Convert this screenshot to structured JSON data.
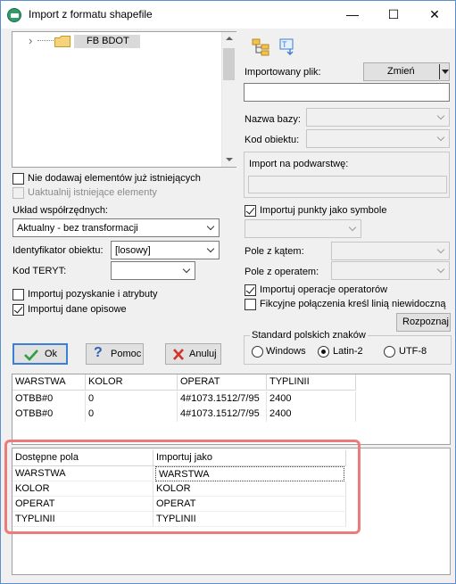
{
  "window": {
    "title": "Import z formatu shapefile",
    "minimize_glyph": "—",
    "maximize_glyph": "☐",
    "close_glyph": "✕"
  },
  "tree": {
    "node_label": "FB BDOT",
    "expand_glyph": "›"
  },
  "left_options": {
    "no_add_existing": "Nie dodawaj elementów już istniejących",
    "update_existing": "Uaktualnij istniejące elementy",
    "coord_system_label": "Układ współrzędnych:",
    "coord_system_value": "Aktualny - bez transformacji",
    "object_id_label": "Identyfikator  obiektu:",
    "object_id_value": "[losowy]",
    "teryt_label": "Kod TERYT:",
    "teryt_value": "",
    "import_acquisition": "Importuj pozyskanie i atrybuty",
    "import_descriptive": "Importuj dane opisowe"
  },
  "checks": {
    "no_add_existing": false,
    "update_existing": false,
    "import_acquisition": false,
    "import_descriptive": true,
    "import_points": true,
    "import_operator_ops": true,
    "fictional_connections": false
  },
  "buttons": {
    "ok": "Ok",
    "help": "Pomoc",
    "cancel": "Anuluj",
    "change": "Zmień",
    "detect": "Rozpoznaj"
  },
  "right_panel": {
    "imported_file_label": "Importowany plik:",
    "imported_file_value": "",
    "db_name_label": "Nazwa bazy:",
    "object_code_label": "Kod obiektu:",
    "import_sublayer_label": "Import na podwarstwę:",
    "import_points_label": "Importuj punkty jako symbole",
    "angle_field_label": "Pole z kątem:",
    "operator_field_label": "Pole z operatem:",
    "import_operator_ops": "Importuj operacje operatorów",
    "fictional_connections": "Fikcyjne połączenia kreśl linią niewidoczną"
  },
  "encoding": {
    "legend": "Standard polskich znaków",
    "options": [
      "Windows",
      "Latin-2",
      "UTF-8"
    ],
    "selected": "Latin-2"
  },
  "data_grid": {
    "columns": [
      "WARSTWA",
      "KOLOR",
      "OPERAT",
      "TYPLINII"
    ],
    "rows": [
      [
        "OTBB#0",
        "0",
        "4#1073.1512/7/95",
        "2400"
      ],
      [
        "OTBB#0",
        "0",
        "4#1073.1512/7/95",
        "2400"
      ]
    ]
  },
  "field_map": {
    "columns": [
      "Dostępne pola",
      "Importuj jako"
    ],
    "rows": [
      [
        "WARSTWA",
        "WARSTWA"
      ],
      [
        "KOLOR",
        "KOLOR"
      ],
      [
        "OPERAT",
        "OPERAT"
      ],
      [
        "TYPLINII",
        "TYPLINII"
      ]
    ]
  },
  "colors": {
    "highlight": "#ee7b7b",
    "ok_check": "#2e9d3a",
    "cancel_x": "#d0342c",
    "folder": "#f2c24f"
  }
}
